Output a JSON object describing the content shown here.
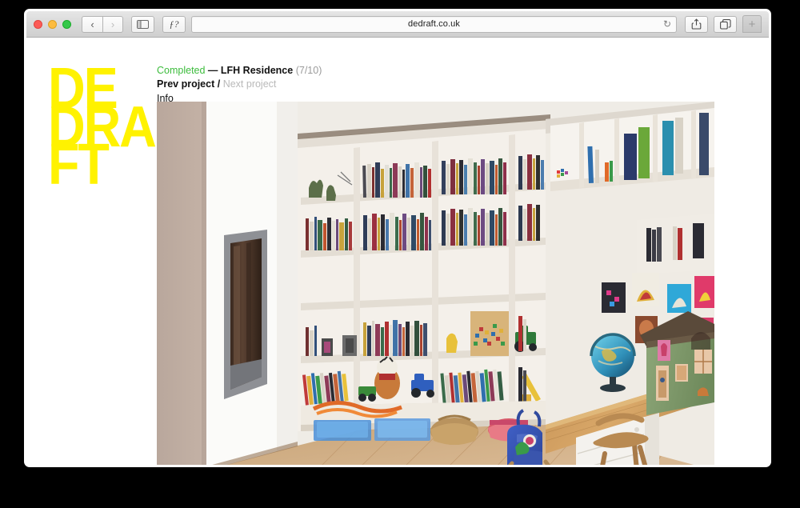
{
  "browser": {
    "traffic_lights": [
      "close",
      "minimize",
      "maximize"
    ],
    "back_glyph": "‹",
    "forward_glyph": "›",
    "sidebar_icon": "sidebar-icon",
    "reader_label": "ƒ?",
    "url": "dedraft.co.uk",
    "reload_glyph": "↻",
    "share_icon": "share-icon",
    "tabs_icon": "tabs-icon",
    "newtab_label": "+"
  },
  "site": {
    "logo_lines": [
      "DE",
      "DRA",
      "FT"
    ],
    "logo_color": "#fff200"
  },
  "nav": {
    "status": "Completed",
    "dash": " — ",
    "project_title": "LFH Residence",
    "counter": "(7/10)",
    "prev_project": "Prev project",
    "separator": " / ",
    "next_project": "Next project",
    "info": "Info",
    "status_color": "#3cbc3c",
    "inactive_color": "#b9b9b9"
  },
  "photo": {
    "alt": "LFH Residence interior: built-in white bookshelf wall filled with colourful books and toys, wood floor, inset fireplace, wooden desk with globe, green fabric playhouse and blue backpack"
  }
}
